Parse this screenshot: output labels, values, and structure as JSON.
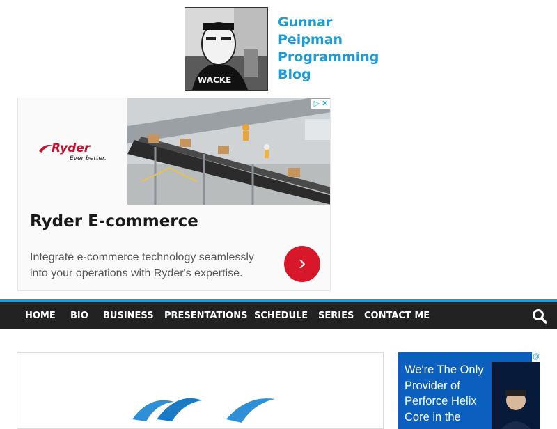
{
  "header": {
    "site_title_lines": [
      "Gunnar",
      "Peipman",
      "Programming",
      "Blog"
    ],
    "title_color": "#1e9bd7"
  },
  "ad": {
    "brand": "Ryder",
    "tagline": "Ever better.",
    "adchoices": "▷ ✕",
    "title": "Ryder E-commerce",
    "description": "Integrate e-commerce technology seamlessly into your operations with Ryder's expertise.",
    "cta_icon": "chevron-right-icon",
    "cta_symbol": "›",
    "cta_color": "#d7182a"
  },
  "nav": {
    "items": [
      "HOME",
      "BIO",
      "BUSINESS",
      "PRESENTATIONS",
      "SCHEDULE",
      "SERIES",
      "CONTACT ME"
    ],
    "search_icon": "search-icon",
    "background": "#222222",
    "accent": "#1e9bd7"
  },
  "sidebar_ad": {
    "text": "We're The Only Provider of Perforce Helix Core in the",
    "badge": "@",
    "background": "#0a5fbf"
  }
}
